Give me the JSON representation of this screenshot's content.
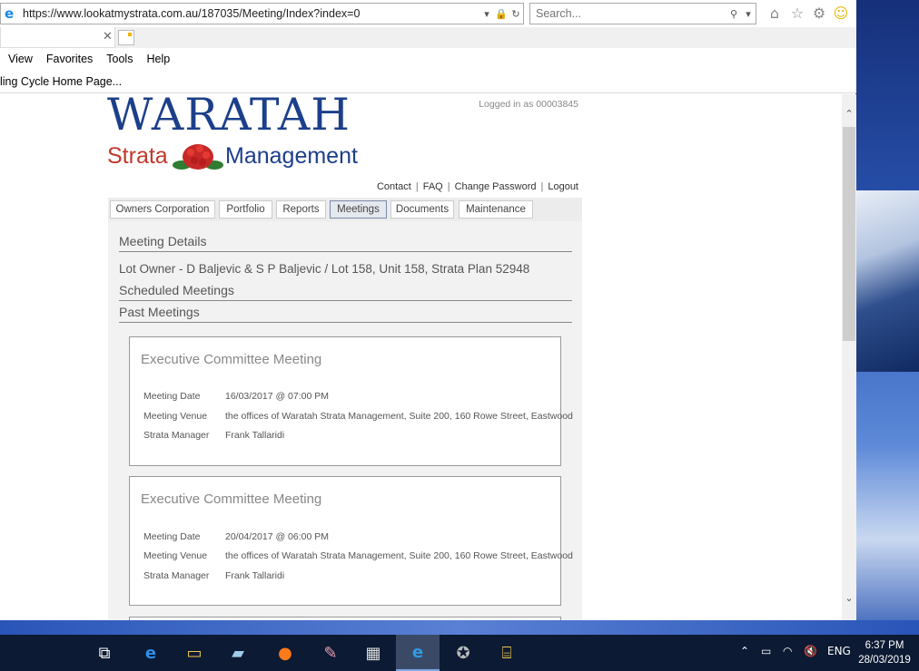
{
  "browser": {
    "url": "https://www.lookatmystrata.com.au/187035/Meeting/Index?index=0",
    "search_placeholder": "Search...",
    "menu": [
      "View",
      "Favorites",
      "Tools",
      "Help"
    ],
    "favorites_bar_text": "ling Cycle Home Page..."
  },
  "page": {
    "logo_waratah": "WARATAH",
    "logo_strata": "Strata",
    "logo_management": "Management",
    "logged_in": "Logged in as 00003845",
    "links": {
      "contact": "Contact",
      "faq": "FAQ",
      "change_password": "Change Password",
      "logout": "Logout"
    },
    "nav": [
      "Owners Corporation",
      "Portfolio",
      "Reports",
      "Meetings",
      "Documents",
      "Maintenance"
    ],
    "active_nav": "Meetings",
    "meeting_details_heading": "Meeting Details",
    "lot_owner": "Lot Owner - D Baljevic & S P Baljevic / Lot 158, Unit 158, Strata Plan 52948",
    "scheduled_heading": "Scheduled Meetings",
    "past_heading": "Past Meetings",
    "labels": {
      "date": "Meeting Date",
      "venue": "Meeting Venue",
      "manager": "Strata Manager"
    },
    "meetings": [
      {
        "title": "Executive Committee Meeting",
        "date": "16/03/2017 @ 07:00 PM",
        "venue": "the offices of Waratah Strata Management, Suite 200, 160 Rowe Street, Eastwood",
        "manager": "Frank Tallaridi"
      },
      {
        "title": "Executive Committee Meeting",
        "date": "20/04/2017 @ 06:00 PM",
        "venue": "the offices of Waratah Strata Management, Suite 200, 160 Rowe Street, Eastwood",
        "manager": "Frank Tallaridi"
      }
    ]
  },
  "taskbar": {
    "apps": [
      "task-view",
      "edge",
      "file-explorer",
      "notepad",
      "firefox",
      "paint",
      "calculator",
      "internet-explorer",
      "gimp",
      "network-app"
    ],
    "language": "ENG",
    "time": "6:37 PM",
    "date": "28/03/2019"
  },
  "colors": {
    "brand_blue": "#1c3f8a",
    "brand_red": "#c0392b",
    "window_border": "#c0392b"
  }
}
